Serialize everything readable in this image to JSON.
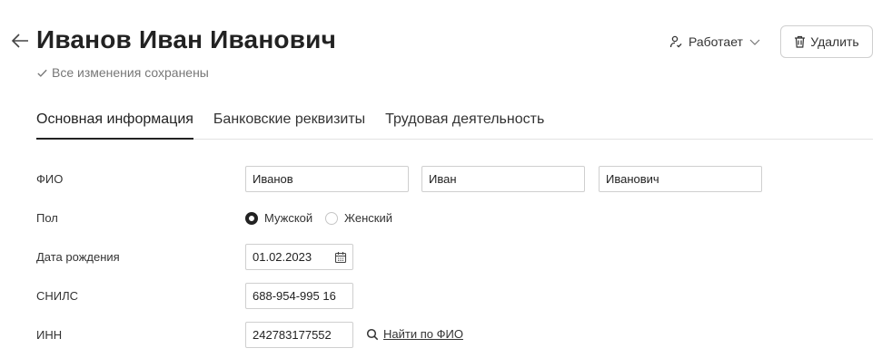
{
  "header": {
    "title": "Иванов Иван Иванович",
    "saved_status": "Все изменения сохранены",
    "employment_status": "Работает",
    "delete_label": "Удалить"
  },
  "tabs": [
    {
      "label": "Основная информация",
      "active": true
    },
    {
      "label": "Банковские реквизиты",
      "active": false
    },
    {
      "label": "Трудовая деятельность",
      "active": false
    }
  ],
  "form": {
    "fio": {
      "label": "ФИО",
      "last_name": "Иванов",
      "first_name": "Иван",
      "middle_name": "Иванович"
    },
    "gender": {
      "label": "Пол",
      "options": [
        "Мужской",
        "Женский"
      ],
      "selected": "Мужской"
    },
    "birth_date": {
      "label": "Дата рождения",
      "value": "01.02.2023"
    },
    "snils": {
      "label": "СНИЛС",
      "value": "688-954-995 16"
    },
    "inn": {
      "label": "ИНН",
      "value": "242783177552",
      "find_link": "Найти по ФИО"
    }
  },
  "icons": [
    "back-arrow-icon",
    "check-icon",
    "person-icon",
    "chevron-down-icon",
    "trash-icon",
    "calendar-icon",
    "search-icon"
  ]
}
